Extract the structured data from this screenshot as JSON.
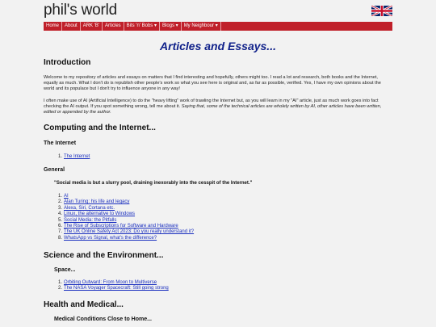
{
  "site": {
    "title": "phil's world"
  },
  "nav": {
    "items": [
      {
        "label": "Home"
      },
      {
        "label": "About"
      },
      {
        "label": "ARK 'B'"
      },
      {
        "label": "Articles"
      },
      {
        "label": "Bits 'n' Bobs ▾"
      },
      {
        "label": "Blogs ▾"
      },
      {
        "label": "My Neighbour ▾"
      }
    ]
  },
  "page": {
    "heading": "Articles and Essays...",
    "introduction": {
      "heading": "Introduction",
      "para1": "Welcome to my repository of articles and essays on matters that I find interesting and hopefully, others might too. I read a lot and research, both books and the Internet, equally as much. What I don't do is republish other people's work so what you see here is original and, as far as possible, verified. Yes, I have my own opinions about the world and its populace but I don't try to influence anyone in any way!",
      "para2_plain": "I often make use of AI (Artificial Intelligence) to do the \"heavy lifting\" work of trawling the Internet but, as you will learn in my \"AI\" article, just as much work goes into fact checking the AI output. If you spot something wrong, tell me about it. ",
      "para2_italic": "Saying that, some of the technical articles are wholely written by AI, other articles have been written, edited or appended by the author."
    },
    "computing": {
      "heading": "Computing and the Internet...",
      "internet_heading": "The Internet",
      "internet_items": [
        {
          "num": "1.",
          "label": "The Internet"
        }
      ],
      "general_heading": "General",
      "quote": "\"Social media is but a slurry pool, draining inexorably into the cesspit of the Internet.\"",
      "general_items": [
        {
          "num": "1.",
          "label": "AI"
        },
        {
          "num": "2.",
          "label": "Alan Turing: his life and legacy"
        },
        {
          "num": "3.",
          "label": "Alexa, Siri, Cortana etc."
        },
        {
          "num": "4.",
          "label": "Linux, the alternative to Windows"
        },
        {
          "num": "5.",
          "label": "Social Media: the Pitfalls"
        },
        {
          "num": "6.",
          "label": "The Rise of Subscriptions for Software and Hardware"
        },
        {
          "num": "7.",
          "label": "The UK Online Safety Act 2023: Do you really understand it?"
        },
        {
          "num": "8.",
          "label": "WhatsApp vs Signal, what's the difference?"
        }
      ]
    },
    "science": {
      "heading": "Science and the Environment...",
      "space_heading": "Space...",
      "space_items": [
        {
          "num": "1.",
          "label": "Orbiting Outward: From Moon to Multiverse"
        },
        {
          "num": "2.",
          "label": "The NASA Voyager Spacecraft: Still going strong"
        }
      ]
    },
    "health": {
      "heading": "Health and Medical...",
      "sub_heading": "Medical Conditions Close to Home..."
    }
  },
  "colors": {
    "nav_bg": "#c0202a",
    "heading_blue": "#10218a",
    "link": "#1a2fbf"
  },
  "icons": {
    "flag": "union-jack-flag-icon"
  }
}
